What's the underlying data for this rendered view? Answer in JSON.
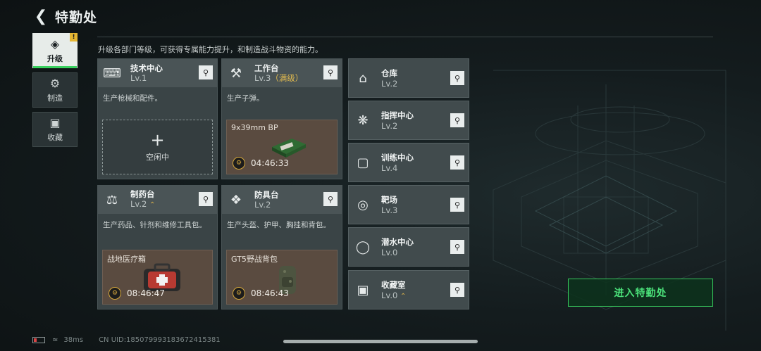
{
  "header": {
    "title": "特勤处"
  },
  "description": "升级各部门等级，可获得专属能力提升，和制造战斗物资的能力。",
  "sidenav": [
    {
      "label": "升级",
      "icon": "upgrade-icon",
      "active": true,
      "badge": "!"
    },
    {
      "label": "制造",
      "icon": "gears-icon",
      "active": false
    },
    {
      "label": "收藏",
      "icon": "collection-icon",
      "active": false
    }
  ],
  "cards": [
    {
      "name": "技术中心",
      "level": "Lv.1",
      "desc": "生产枪械和配件。",
      "icon": "tech-center-icon",
      "slot": {
        "idle": true,
        "label": "空闲中"
      }
    },
    {
      "name": "工作台",
      "level": "Lv.3",
      "level_extra": "（满级）",
      "desc": "生产子弹。",
      "icon": "workbench-icon",
      "slot": {
        "idle": false,
        "item": "9x39mm BP",
        "time": "04:46:33",
        "item_icon": "ammo-box-icon"
      }
    },
    {
      "name": "制药台",
      "level": "Lv.2",
      "upgradable": true,
      "desc": "生产药品、针剂和维修工具包。",
      "icon": "pharmacy-icon",
      "slot": {
        "idle": false,
        "item": "战地医疗箱",
        "time": "08:46:47",
        "item_icon": "medkit-icon"
      }
    },
    {
      "name": "防具台",
      "level": "Lv.2",
      "desc": "生产头盔、护甲、胸挂和背包。",
      "icon": "armor-bench-icon",
      "slot": {
        "idle": false,
        "item": "GT5野战背包",
        "time": "08:46:43",
        "item_icon": "backpack-icon"
      }
    }
  ],
  "small_cards": [
    {
      "name": "仓库",
      "level": "Lv.2",
      "icon": "warehouse-icon"
    },
    {
      "name": "指挥中心",
      "level": "Lv.2",
      "icon": "command-center-icon"
    },
    {
      "name": "训练中心",
      "level": "Lv.4",
      "icon": "dumbbell-icon"
    },
    {
      "name": "靶场",
      "level": "Lv.3",
      "icon": "target-icon"
    },
    {
      "name": "潜水中心",
      "level": "Lv.0",
      "icon": "diving-mask-icon"
    },
    {
      "name": "收藏室",
      "level": "Lv.0",
      "upgradable": true,
      "icon": "collection-room-icon"
    }
  ],
  "enter_button": "进入特勤处",
  "status": {
    "ping": "38ms",
    "uid": "CN UID:1850799931836724153​81"
  },
  "colors": {
    "accent_green": "#3ad15f",
    "gold": "#e5bd4f"
  }
}
